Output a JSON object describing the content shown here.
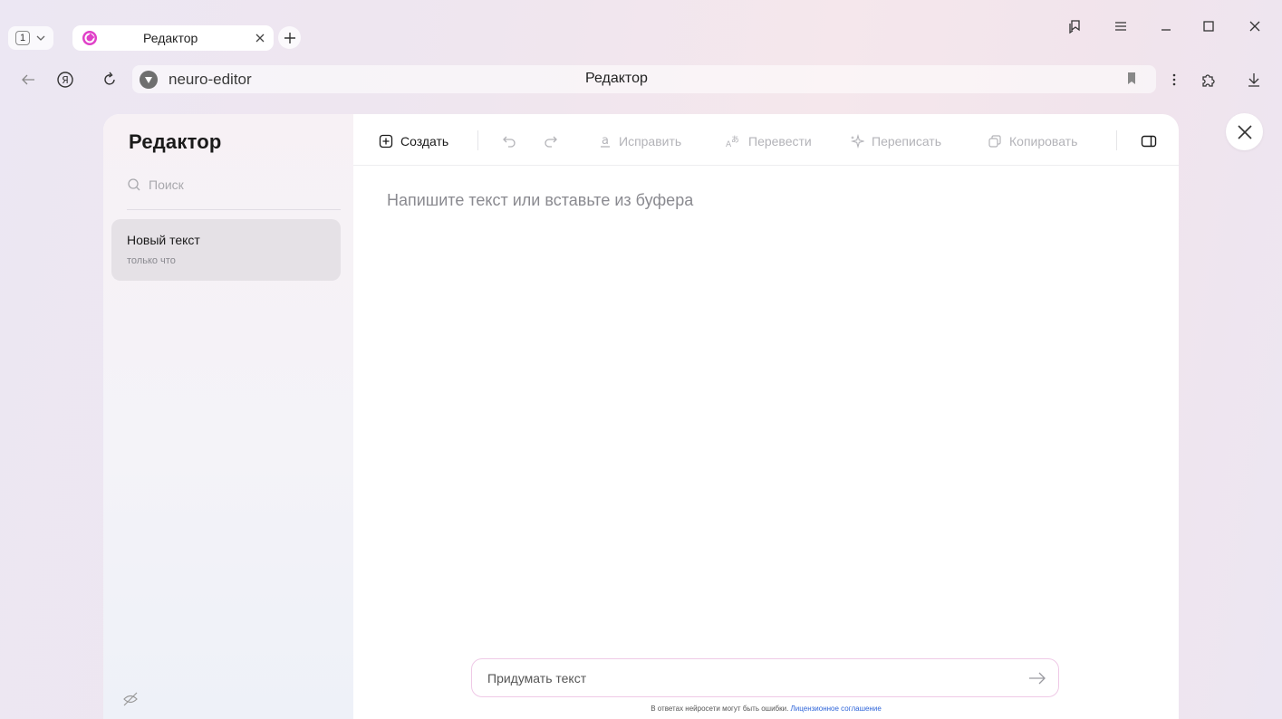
{
  "browser": {
    "tab_count": "1",
    "tab_title": "Редактор",
    "address_url": "neuro-editor",
    "address_title": "Редактор"
  },
  "sidebar": {
    "title": "Редактор",
    "search_placeholder": "Поиск",
    "documents": [
      {
        "title": "Новый текст",
        "time": "только что"
      }
    ]
  },
  "toolbar": {
    "create_label": "Создать",
    "fix_label": "Исправить",
    "translate_label": "Перевести",
    "rewrite_label": "Переписать",
    "copy_label": "Копировать"
  },
  "editor": {
    "placeholder": "Напишите текст или вставьте из буфера"
  },
  "prompt": {
    "placeholder": "Придумать текст"
  },
  "footer": {
    "disclaimer": "В ответах нейросети могут быть ошибки.",
    "license_link": "Лицензионное соглашение"
  },
  "colors": {
    "accent_favicon": "#e040c8",
    "link": "#2e64d8",
    "prompt_border": "#efc9e6"
  },
  "icons": {
    "tabs": [
      "chevron-down-icon",
      "editor-favicon-icon",
      "close-icon",
      "plus-icon"
    ],
    "window": [
      "collections-icon",
      "menu-icon",
      "minimize-icon",
      "maximize-icon",
      "close-icon"
    ],
    "nav": [
      "back-arrow-icon",
      "yandex-icon",
      "reload-icon",
      "site-icon",
      "bookmark-icon",
      "more-icon",
      "extensions-icon",
      "download-icon"
    ],
    "toolbar": [
      "plus-square-icon",
      "undo-icon",
      "redo-icon",
      "fix-icon",
      "translate-icon",
      "sparkle-icon",
      "copy-icon",
      "panel-toggle-icon"
    ]
  }
}
